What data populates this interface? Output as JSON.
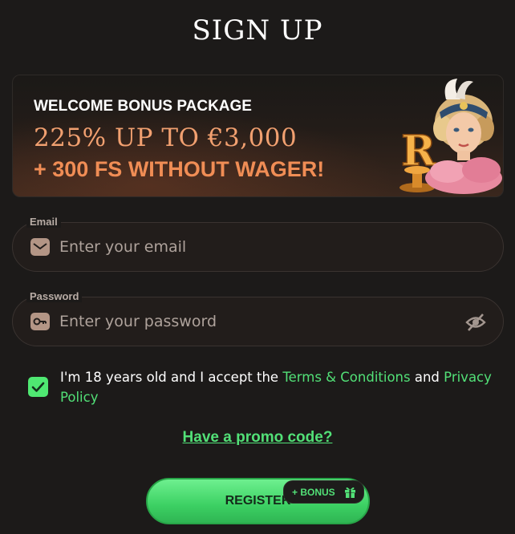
{
  "page": {
    "title": "SIGN UP"
  },
  "bonus": {
    "heading": "WELCOME BONUS PACKAGE",
    "offer": "225% UP TO €3,000",
    "extra": "+ 300 FS WITHOUT WAGER!",
    "art_icon": "casino-mascot-lady-with-letter-r"
  },
  "email": {
    "label": "Email",
    "placeholder": "Enter your email",
    "value": "",
    "icon": "envelope-icon"
  },
  "password": {
    "label": "Password",
    "placeholder": "Enter your password",
    "value": "",
    "icon": "key-icon",
    "toggle_icon": "eye-slash-icon"
  },
  "consent": {
    "checked": true,
    "text_before": "I'm 18 years old and I accept the ",
    "terms_link": "Terms & Conditions",
    "text_middle": " and ",
    "privacy_link": "Privacy Policy"
  },
  "promo": {
    "label": "Have a promo code?"
  },
  "register": {
    "label": "REGISTER",
    "badge": "+ BONUS",
    "badge_icon": "gift-icon"
  },
  "colors": {
    "background": "#1c1a19",
    "accent_green": "#52e077",
    "offer_orange": "#f1a070"
  }
}
